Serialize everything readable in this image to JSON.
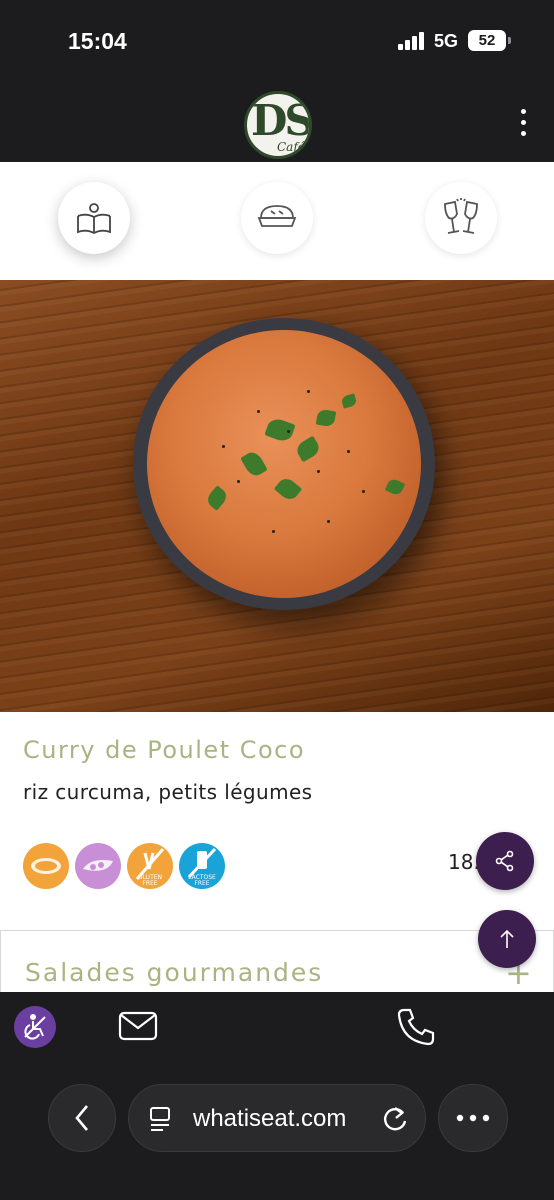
{
  "status_bar": {
    "time": "15:04",
    "network": "5G",
    "battery": "52"
  },
  "header": {
    "logo_text": "DS",
    "logo_sub": "Café"
  },
  "category_nav": {
    "items": [
      "menu-book-icon",
      "pie-icon",
      "champagne-glasses-icon"
    ]
  },
  "dish": {
    "name": "Curry de Poulet Coco",
    "description": "riz curcuma, petits légumes",
    "price": "18.",
    "badges": [
      "peanut-icon",
      "soy-icon",
      "gluten-free-icon",
      "lactose-free-icon"
    ],
    "badge_labels": {
      "gluten_free": "GLUTEN FREE",
      "lactose_free": "LACTOSE FREE"
    }
  },
  "section": {
    "title": "Salades gourmandes",
    "toggle": "+"
  },
  "browser": {
    "url": "whatiseat.com"
  },
  "colors": {
    "accent": "#a8b583",
    "fab": "#3d1f4f",
    "a11y": "#6b3fa0"
  }
}
